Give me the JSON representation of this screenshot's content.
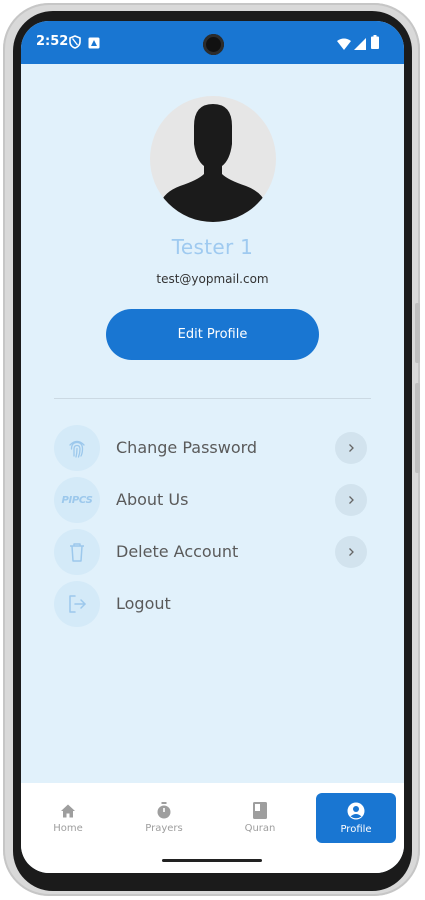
{
  "status_bar": {
    "time": "2:52"
  },
  "profile": {
    "name": "Tester 1",
    "email": "test@yopmail.com",
    "edit_button": "Edit Profile"
  },
  "menu": [
    {
      "label": "Change Password",
      "icon": "fingerprint-icon",
      "has_chevron": true
    },
    {
      "label": "About Us",
      "icon": "pipcs-logo",
      "logo_text": "PIPCS",
      "has_chevron": true
    },
    {
      "label": "Delete Account",
      "icon": "trash-icon",
      "has_chevron": true
    },
    {
      "label": "Logout",
      "icon": "logout-icon",
      "has_chevron": false
    }
  ],
  "bottom_nav": [
    {
      "label": "Home",
      "icon": "home-icon",
      "active": false
    },
    {
      "label": "Prayers",
      "icon": "stopwatch-icon",
      "active": false
    },
    {
      "label": "Quran",
      "icon": "book-icon",
      "active": false
    },
    {
      "label": "Profile",
      "icon": "profile-icon",
      "active": true
    }
  ],
  "colors": {
    "primary": "#1976d2",
    "background": "#e1f1fb",
    "name_text": "#9fcaf0",
    "icon_bg": "#d4eaf8"
  }
}
